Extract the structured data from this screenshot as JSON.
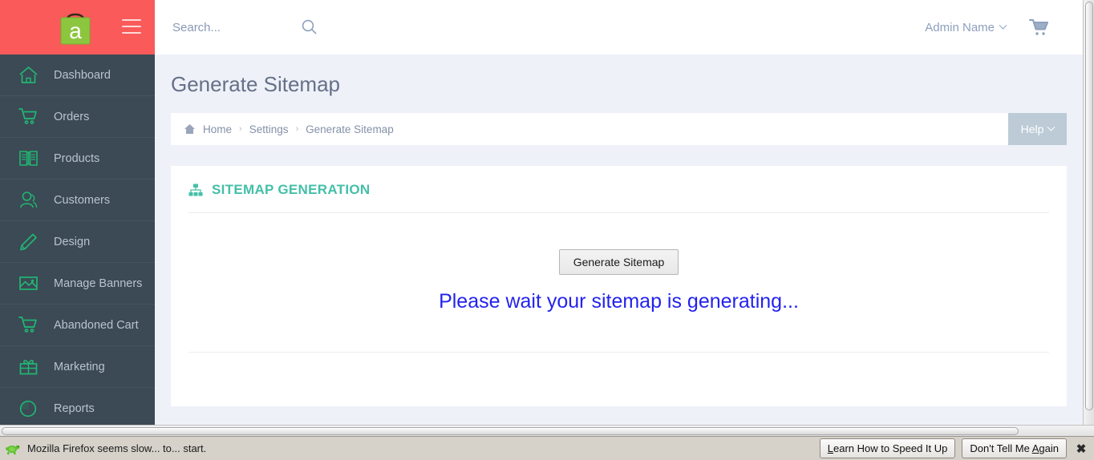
{
  "header": {
    "logo_letter": "a",
    "menu_icon": "hamburger-icon",
    "search_placeholder": "Search...",
    "search_value": "",
    "search_icon": "search-icon",
    "admin_name": "Admin Name",
    "cart_icon": "cart-icon"
  },
  "sidebar": {
    "items": [
      {
        "label": "Dashboard",
        "icon": "home-icon"
      },
      {
        "label": "Orders",
        "icon": "shopping-cart-icon"
      },
      {
        "label": "Products",
        "icon": "book-icon"
      },
      {
        "label": "Customers",
        "icon": "user-icon"
      },
      {
        "label": "Design",
        "icon": "pencil-icon"
      },
      {
        "label": "Manage Banners",
        "icon": "image-icon"
      },
      {
        "label": "Abandoned Cart",
        "icon": "cart-icon"
      },
      {
        "label": "Marketing",
        "icon": "gift-icon"
      },
      {
        "label": "Reports",
        "icon": "pie-chart-icon"
      }
    ]
  },
  "page": {
    "title": "Generate Sitemap",
    "breadcrumb": {
      "home_icon": "home-icon",
      "items": [
        "Home",
        "Settings",
        "Generate Sitemap"
      ],
      "separator": "›"
    },
    "help_button": {
      "label": "Help",
      "icon": "chevron-down-icon"
    }
  },
  "card": {
    "icon": "sitemap-icon",
    "title": "SITEMAP GENERATION",
    "generate_button": "Generate Sitemap",
    "status_message": "Please wait your sitemap is generating..."
  },
  "notification": {
    "icon": "turtle-icon",
    "message": "Mozilla Firefox seems slow... to... start.",
    "learn_button": {
      "pre": "",
      "accel": "L",
      "post": "earn How to Speed It Up"
    },
    "dismiss_button": {
      "pre": "Don't Tell Me ",
      "accel": "A",
      "post": "gain"
    },
    "close_icon": "close-icon"
  },
  "colors": {
    "brand_red": "#fa5a5a",
    "sidebar_bg": "#3b4a54",
    "icon_green": "#22b573",
    "accent_teal": "#44bfa8",
    "status_blue": "#2323ee",
    "page_bg": "#eef1f8"
  }
}
